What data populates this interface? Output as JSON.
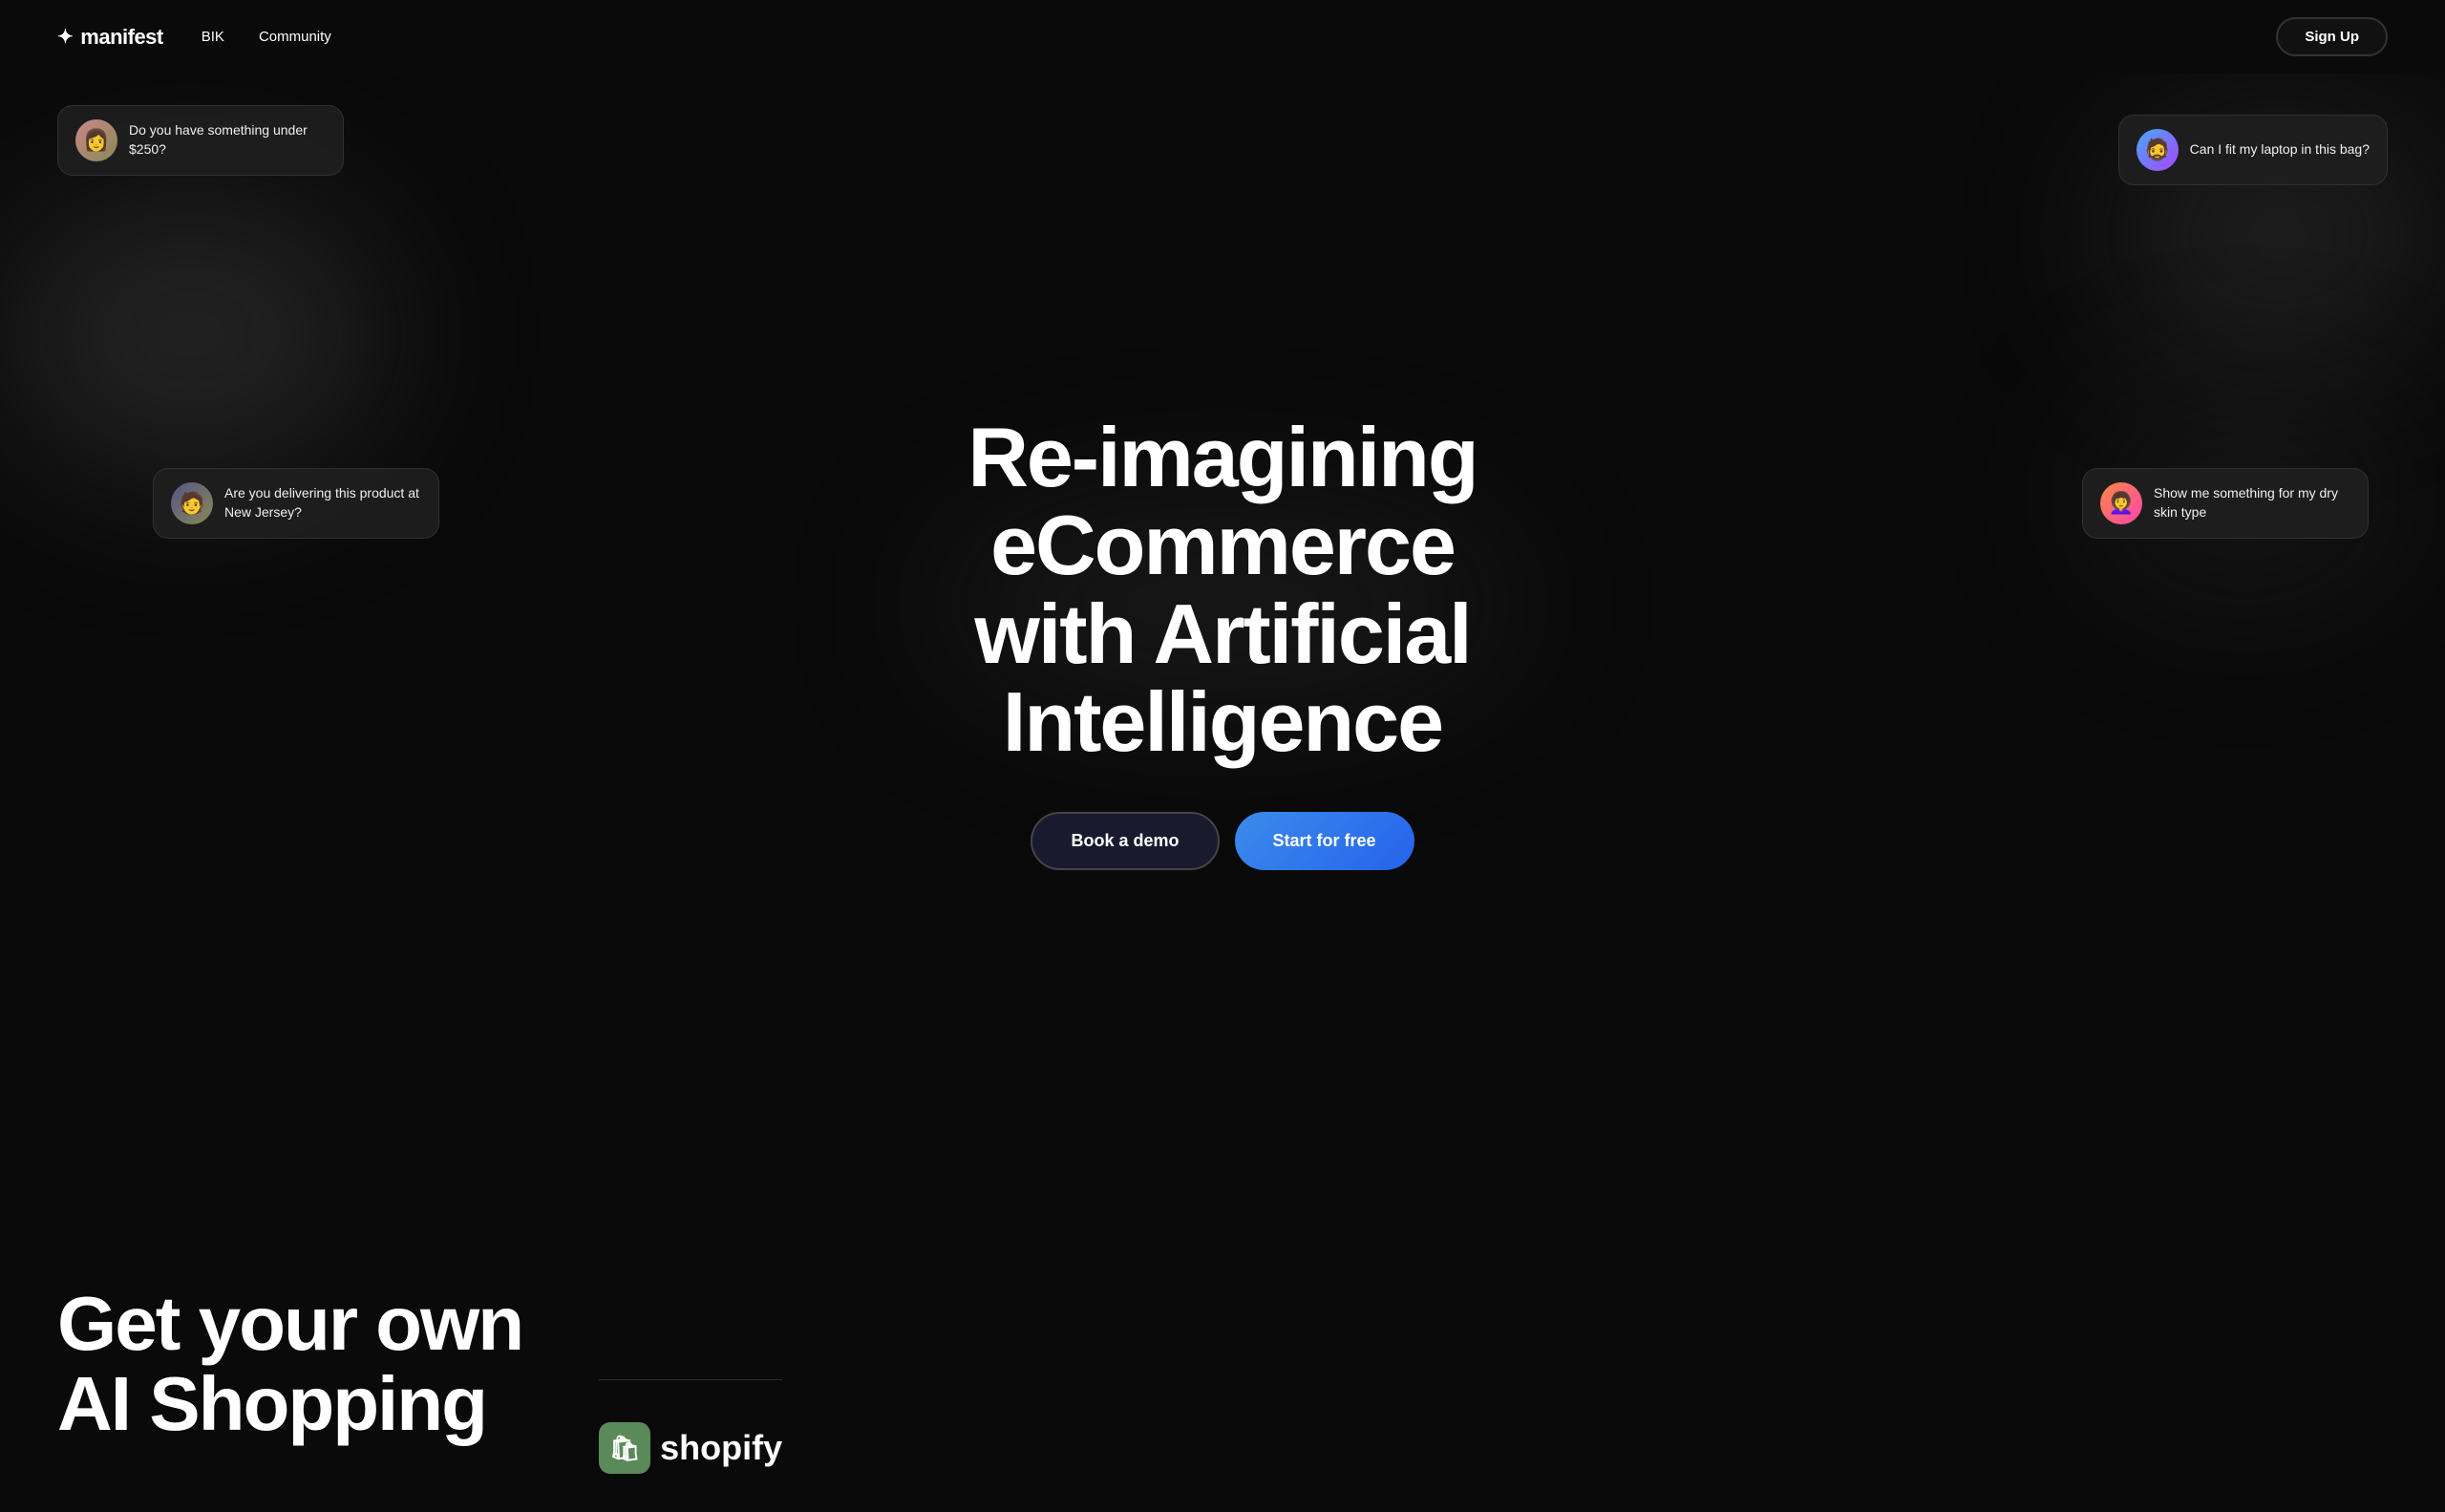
{
  "nav": {
    "logo_text": "manifest",
    "logo_star": "✦",
    "links": [
      {
        "id": "bik",
        "label": "BIK"
      },
      {
        "id": "community",
        "label": "Community"
      }
    ],
    "signup_label": "Sign Up"
  },
  "hero": {
    "title_line1": "Re-imagining eCommerce",
    "title_line2": "with Artificial Intelligence",
    "buttons": {
      "demo_label": "Book a demo",
      "free_label": "Start for free"
    },
    "chat_bubbles": [
      {
        "id": "bubble-top-left",
        "text": "Do you have something under $250?",
        "avatar_emoji": "👩"
      },
      {
        "id": "bubble-mid-left",
        "text": "Are you delivering this product at New Jersey?",
        "avatar_emoji": "🧑"
      },
      {
        "id": "bubble-top-right",
        "text": "Can I fit my laptop in this bag?",
        "avatar_emoji": "🧔"
      },
      {
        "id": "bubble-mid-right",
        "text": "Show me something for my dry skin type",
        "avatar_emoji": "👩‍🦱"
      }
    ]
  },
  "section2": {
    "title_line1": "Get your own",
    "title_line2": "AI Shopping",
    "shopify_label": "shopify"
  }
}
